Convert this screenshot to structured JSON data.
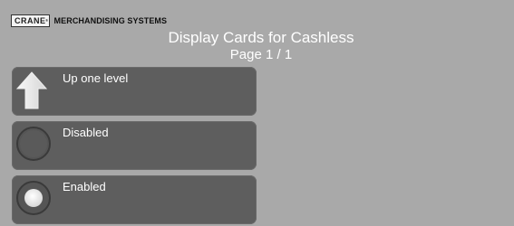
{
  "header": {
    "logo_mark": "CRANE",
    "logo_text": "MERCHANDISING SYSTEMS",
    "title": "Display Cards for Cashless",
    "page": "Page 1 / 1"
  },
  "options": {
    "up": {
      "label": "Up one level",
      "icon": "up-arrow-icon"
    },
    "disabled": {
      "label": "Disabled",
      "icon": "radio-off-icon",
      "selected": false
    },
    "enabled": {
      "label": "Enabled",
      "icon": "radio-on-icon",
      "selected": true
    }
  },
  "colors": {
    "background": "#a9a9a9",
    "button": "#5e5e5e",
    "text": "#ffffff"
  }
}
